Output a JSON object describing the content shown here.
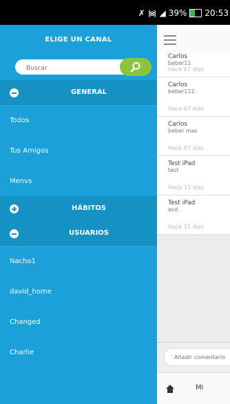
{
  "status_bar": {
    "battery": "39%",
    "time": "20:53"
  },
  "drawer": {
    "title": "ELIGE UN CANAL",
    "search_placeholder": "Buscar",
    "sections": {
      "general": "GENERAL",
      "habitos": "HÁBITOS",
      "usuarios": "USUARIOS"
    },
    "general_items": [
      "Todos",
      "Tus Amigos",
      "Menvs"
    ],
    "usuarios_items": [
      "Nacho1",
      "david_home",
      "Changed",
      "Charlie"
    ]
  },
  "feed": {
    "first": {
      "author": "Carlos",
      "text": "beber11",
      "time": "Hace 67 dias"
    },
    "cards": [
      {
        "author": "Carlos",
        "text": "beber112",
        "time": "Hace 67 dias"
      },
      {
        "author": "Carlos",
        "text": "beber mas",
        "time": "Hace 67 dias"
      },
      {
        "author": "Test iPad",
        "text": "test",
        "time": "Hace 15 dias"
      },
      {
        "author": "Test iPad",
        "text": "asd",
        "time": "Hace 15 dias"
      }
    ],
    "comment_placeholder": "Añadir comentario",
    "bottom_tab": "Mi"
  },
  "colors": {
    "drawer_bg": "#1ca0d9",
    "section_bg": "#1591c4",
    "search_button": "#8bc53f"
  }
}
